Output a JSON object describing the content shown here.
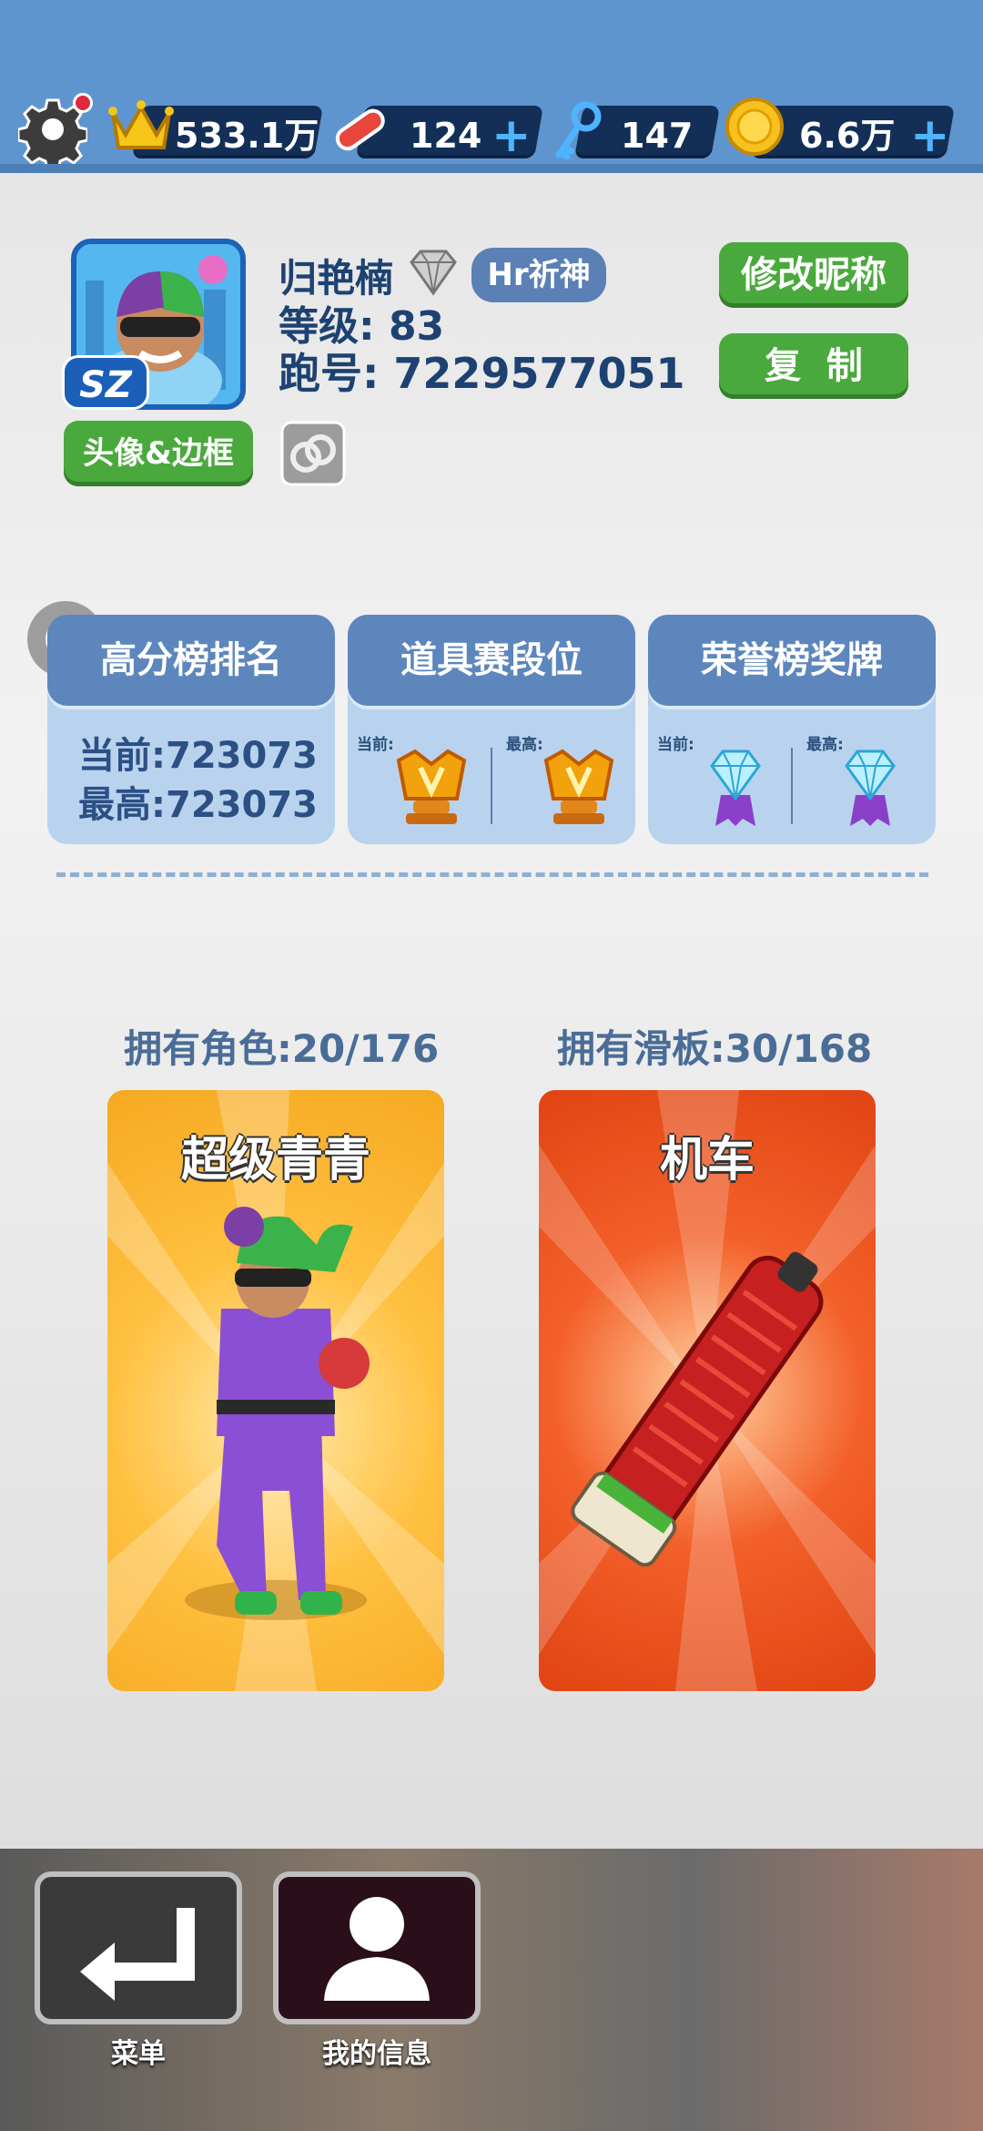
{
  "top_bar": {
    "crowns": "533.1万",
    "boards": "124",
    "keys": "147",
    "coins": "6.6万",
    "plus": "+"
  },
  "profile": {
    "name": "归艳楠",
    "badge": "Hr祈神",
    "level_label": "等级:",
    "level": "83",
    "id_label": "跑号:",
    "id": "7229577051",
    "avatar_tag": "SZ",
    "rename_button": "修改昵称",
    "copy_button": "复  制",
    "avatar_frame_button": "头像&边框"
  },
  "stats": {
    "leaderboard": {
      "title": "高分榜排名",
      "current": "当前:723073",
      "best": "最高:723073"
    },
    "item_tier": {
      "title": "道具赛段位",
      "current_label": "当前:",
      "best_label": "最高:"
    },
    "honor_medal": {
      "title": "荣誉榜奖牌",
      "current_label": "当前:",
      "best_label": "最高:"
    }
  },
  "collection": {
    "characters_label": "拥有角色:20/176",
    "boards_label": "拥有滑板:30/168",
    "character_name": "超级青青",
    "board_name": "机车"
  },
  "bottom_nav": {
    "menu": "菜单",
    "my_info": "我的信息"
  },
  "colors": {
    "topbar": "#5f95cf",
    "green": "#4aa93d",
    "navy": "#1d4272",
    "card_blue": "#b9d3ee"
  }
}
